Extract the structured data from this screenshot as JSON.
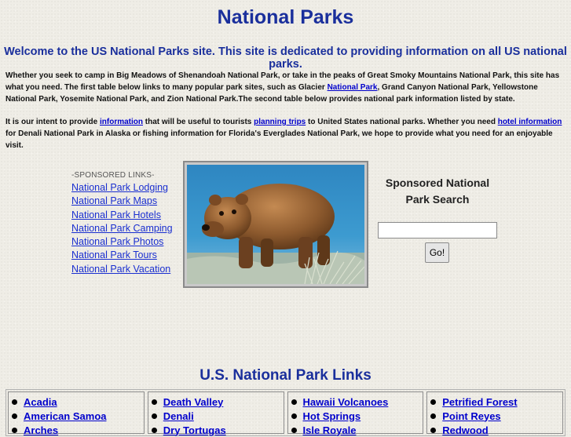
{
  "header": {
    "title": "National Parks",
    "welcome": "Welcome to the US National Parks site. This site is dedicated to providing information on all US national parks."
  },
  "intro": {
    "p1_a": "Whether you seek to camp in Big Meadows of Shenandoah National Park, or take in the peaks of Great Smoky Mountains National Park, this site has what you need. The first table below links to many popular park sites, such as Glacier ",
    "p1_link": "National Park",
    "p1_b": ", Grand Canyon National Park, Yellowstone National Park, Yosemite National Park, and Zion National Park.The second table below provides national park information listed by state.",
    "p2_a": "It is our intent to provide ",
    "p2_link1": "information",
    "p2_b": " that will be useful to tourists ",
    "p2_link2": "planning trips",
    "p2_c": " to United States national parks. Whether you need ",
    "p2_link3": "hotel information",
    "p2_d": " for Denali National Park in Alaska or fishing information for Florida's Everglades National Park, we hope to provide what you need for an enjoyable visit."
  },
  "sponsored": {
    "title": "-SPONSORED LINKS-",
    "links": [
      "National Park Lodging",
      "National Park Maps",
      "National Park Hotels",
      "National Park Camping",
      "National Park Photos",
      "National Park Tours",
      "National Park Vacation"
    ]
  },
  "search": {
    "title": "Sponsored National Park Search",
    "input_value": "",
    "button_label": "Go!"
  },
  "links_section": {
    "title": "U.S. National Park Links",
    "columns": [
      [
        "Acadia",
        "American Samoa",
        "Arches"
      ],
      [
        "Death Valley",
        "Denali",
        "Dry Tortugas"
      ],
      [
        "Hawaii Volcanoes",
        "Hot Springs",
        "Isle Royale"
      ],
      [
        "Petrified Forest",
        "Point Reyes",
        "Redwood"
      ]
    ]
  },
  "colors": {
    "heading": "#1a2f9c",
    "link": "#0000cc",
    "background": "#efede6"
  },
  "icons": {
    "photo": "brown-bear-photo",
    "bullet": "bullet-icon"
  }
}
